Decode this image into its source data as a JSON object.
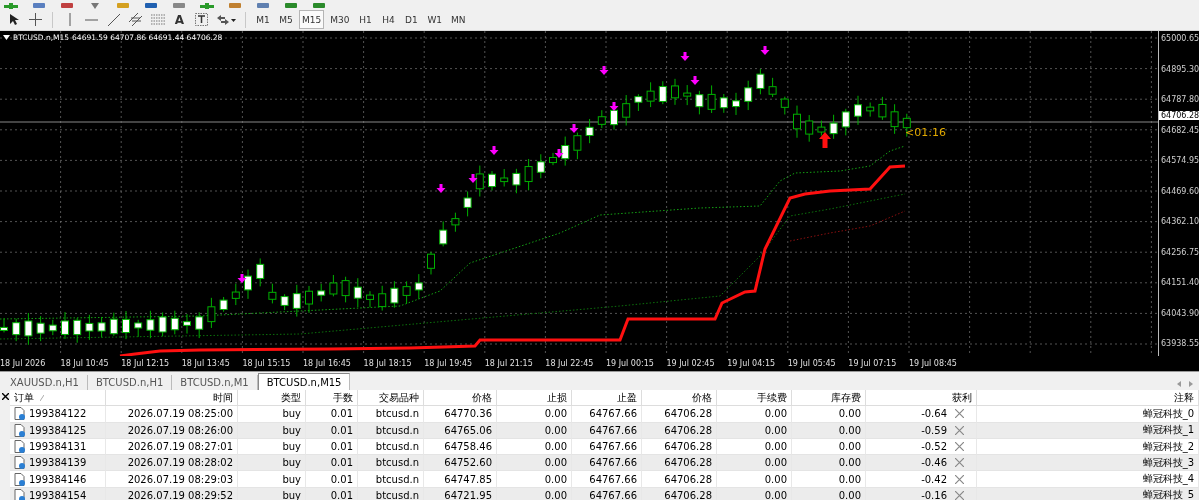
{
  "toolbar": {
    "text_tool_label": "A",
    "timeframes": [
      {
        "label": "M1",
        "selected": false
      },
      {
        "label": "M5",
        "selected": false
      },
      {
        "label": "M15",
        "selected": true
      },
      {
        "label": "M30",
        "selected": false
      },
      {
        "label": "H1",
        "selected": false
      },
      {
        "label": "H4",
        "selected": false
      },
      {
        "label": "D1",
        "selected": false
      },
      {
        "label": "W1",
        "selected": false
      },
      {
        "label": "MN",
        "selected": false
      }
    ]
  },
  "chart": {
    "header": {
      "symbol": "BTCUSD.n,M15",
      "ohlc": "64691.59 64707.86 64691.44 64706.28"
    },
    "price_ticks": [
      "65000.65",
      "64895.30",
      "64787.80",
      "64682.45",
      "64574.95",
      "64469.60",
      "64362.10",
      "64256.75",
      "64151.40",
      "64043.90",
      "63938.55"
    ],
    "current_price": "64706.28",
    "countdown": "<01:16",
    "time_labels": [
      "18 Jul 2026",
      "18 Jul 10:45",
      "18 Jul 12:15",
      "18 Jul 13:45",
      "18 Jul 15:15",
      "18 Jul 16:45",
      "18 Jul 18:15",
      "18 Jul 19:45",
      "18 Jul 21:15",
      "18 Jul 22:45",
      "19 Jul 00:15",
      "19 Jul 02:45",
      "19 Jul 04:15",
      "19 Jul 05:45",
      "19 Jul 07:15",
      "19 Jul 08:45"
    ]
  },
  "chart_tabs": [
    {
      "label": "XAUUSD.n,H1",
      "selected": false
    },
    {
      "label": "BTCUSD.n,H1",
      "selected": false
    },
    {
      "label": "BTCUSD.n,M1",
      "selected": false
    },
    {
      "label": "BTCUSD.n,M15",
      "selected": true
    }
  ],
  "orders_table": {
    "columns": [
      "订单",
      "时间",
      "类型",
      "手数",
      "交易品种",
      "价格",
      "止损",
      "止盈",
      "价格",
      "手续费",
      "库存费",
      "获利",
      "注释"
    ],
    "rows": [
      {
        "cells": [
          "199384122",
          "2026.07.19 08:25:00",
          "buy",
          "0.01",
          "btcusd.n",
          "64770.36",
          "0.00",
          "64767.66",
          "64706.28",
          "0.00",
          "0.00",
          "-0.64",
          "蝉冠科技_0"
        ]
      },
      {
        "cells": [
          "199384125",
          "2026.07.19 08:26:00",
          "buy",
          "0.01",
          "btcusd.n",
          "64765.06",
          "0.00",
          "64767.66",
          "64706.28",
          "0.00",
          "0.00",
          "-0.59",
          "蝉冠科技_1"
        ]
      },
      {
        "cells": [
          "199384131",
          "2026.07.19 08:27:01",
          "buy",
          "0.01",
          "btcusd.n",
          "64758.46",
          "0.00",
          "64767.66",
          "64706.28",
          "0.00",
          "0.00",
          "-0.52",
          "蝉冠科技_2"
        ]
      },
      {
        "cells": [
          "199384139",
          "2026.07.19 08:28:02",
          "buy",
          "0.01",
          "btcusd.n",
          "64752.60",
          "0.00",
          "64767.66",
          "64706.28",
          "0.00",
          "0.00",
          "-0.46",
          "蝉冠科技_3"
        ]
      },
      {
        "cells": [
          "199384146",
          "2026.07.19 08:29:03",
          "buy",
          "0.01",
          "btcusd.n",
          "64747.85",
          "0.00",
          "64767.66",
          "64706.28",
          "0.00",
          "0.00",
          "-0.42",
          "蝉冠科技_4"
        ]
      },
      {
        "cells": [
          "199384154",
          "2026.07.19 08:29:52",
          "buy",
          "0.01",
          "btcusd.n",
          "64721.95",
          "0.00",
          "64767.66",
          "64706.28",
          "0.00",
          "0.00",
          "-0.16",
          "蝉冠科技_5"
        ]
      }
    ]
  }
}
